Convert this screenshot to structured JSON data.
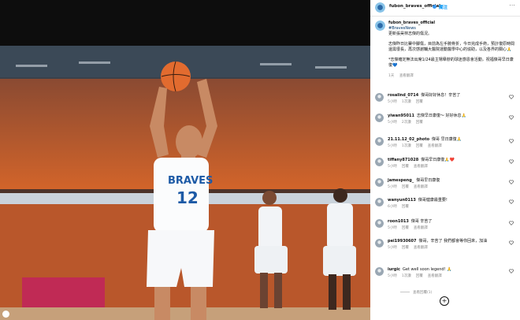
{
  "post": {
    "username": "fubon_braves_official",
    "follow_label": "關注",
    "more_label": "···",
    "caption_tag": "#BravesNews",
    "caption_p1": "更新張昊林志傑的傷況。",
    "caption_p2": "志傑昨日比賽中腳傷，目前為左手腕骨折，今日完成手術，預計復原時間還需很長，再次感謝輔大醫院運動醫學中心的協助，以及各界的關心🙏",
    "caption_p3": "*志傑確定無法出席1/24最主場舉辦的球迷感恩會活動，祝福傑哥早日康復💙",
    "caption_time": "1天",
    "caption_action": "查看翻譯"
  },
  "comments": [
    {
      "user": "rosalind_0714",
      "text": "傑哥好好休息！辛苦了",
      "time": "5小時",
      "likes": "1次讚",
      "reply": "回覆"
    },
    {
      "user": "yiwan95011",
      "text": "志傑早日康復～ 好好休息🙏",
      "time": "5小時",
      "likes": "2次讚",
      "reply": "回覆"
    },
    {
      "user": "21.11.12_02_photo",
      "text": "傑哥 早日康復🙏",
      "time": "5小時",
      "likes": "1次讚",
      "reply": "回覆",
      "extra": "查看翻譯"
    },
    {
      "user": "tiffany871028",
      "text": "傑哥早日康復🙏❤️",
      "time": "5小時",
      "likes": "",
      "reply": "回覆",
      "extra": "查看翻譯"
    },
    {
      "user": "jamespeng_",
      "text": "傑哥早日康復",
      "time": "5小時",
      "likes": "",
      "reply": "回覆",
      "extra": "查看翻譯"
    },
    {
      "user": "wanyun0113",
      "text": "傑哥健康最重要!",
      "time": "6小時",
      "likes": "",
      "reply": "回覆"
    },
    {
      "user": "roon1013",
      "text": "傑哥 辛苦了",
      "time": "5小時",
      "likes": "",
      "reply": "回覆",
      "extra": "查看翻譯"
    },
    {
      "user": "pei19930607",
      "text": "傑哥，辛苦了 我們都會等你回來，加油",
      "time": "5小時",
      "likes": "",
      "reply": "回覆",
      "extra": "查看翻譯"
    },
    {
      "user": "iurgic",
      "text": "Get well soon legend! 🙏",
      "time": "5小時",
      "likes": "1次讚",
      "reply": "回覆",
      "extra": "查看翻譯"
    }
  ],
  "more_replies": "查看回覆(1)",
  "translate_last": "查看翻譯",
  "jersey": {
    "team": "BRAVES",
    "number": "12"
  },
  "colors": {
    "jersey": "#ffffff",
    "accent": "#1d5aa6",
    "crowd": "#c9541f",
    "link": "#0095f6"
  }
}
